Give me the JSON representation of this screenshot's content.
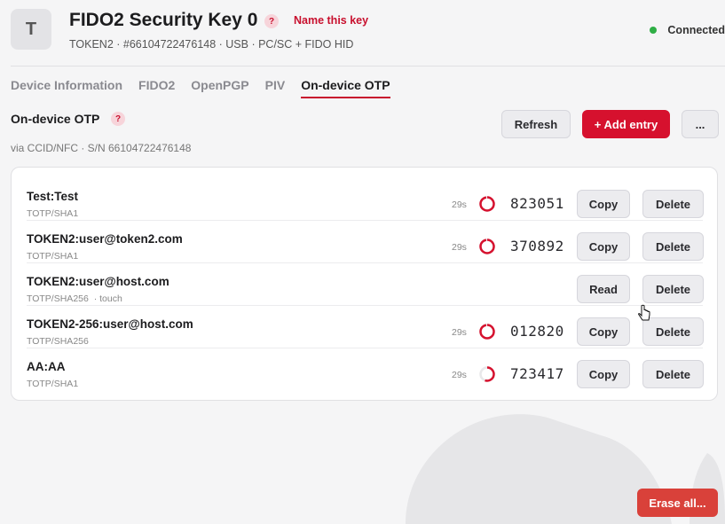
{
  "header": {
    "avatar_letter": "T",
    "title": "FIDO2 Security Key 0",
    "help": "?",
    "name_link": "Name this key",
    "subtitle": "TOKEN2 · #66104722476148 · USB · PC/SC + FIDO HID",
    "status": "Connected",
    "status_color": "#2fae45"
  },
  "tabs": [
    {
      "label": "Device Information",
      "active": false
    },
    {
      "label": "FIDO2",
      "active": false
    },
    {
      "label": "OpenPGP",
      "active": false
    },
    {
      "label": "PIV",
      "active": false
    },
    {
      "label": "On-device OTP",
      "active": true
    }
  ],
  "section": {
    "title": "On-device OTP",
    "help": "?",
    "subtitle": "via CCID/NFC  ·  S/N 66104722476148"
  },
  "toolbar": {
    "refresh_label": "Refresh",
    "add_label": "+ Add entry",
    "more_label": "..."
  },
  "entries": [
    {
      "account": "Test:Test",
      "meta": "TOTP/SHA1",
      "seconds": "29s",
      "code": "823051",
      "action": "Copy",
      "delete": "Delete",
      "remaining": 0.97
    },
    {
      "account": "TOKEN2:user@token2.com",
      "meta": "TOTP/SHA1",
      "seconds": "29s",
      "code": "370892",
      "action": "Copy",
      "delete": "Delete",
      "remaining": 0.97
    },
    {
      "account": "TOKEN2:user@host.com",
      "meta": "TOTP/SHA256",
      "touch": "· touch",
      "action": "Read",
      "delete": "Delete"
    },
    {
      "account": "TOKEN2-256:user@host.com",
      "meta": "TOTP/SHA256",
      "seconds": "29s",
      "code": "012820",
      "action": "Copy",
      "delete": "Delete",
      "remaining": 0.97
    },
    {
      "account": "AA:AA",
      "meta": "TOTP/SHA1",
      "seconds": "29s",
      "code": "723417",
      "action": "Copy",
      "delete": "Delete",
      "remaining": 0.55
    }
  ],
  "footer": {
    "erase_label": "Erase all..."
  },
  "colors": {
    "accent": "#d6112e",
    "danger": "#d9413a"
  }
}
